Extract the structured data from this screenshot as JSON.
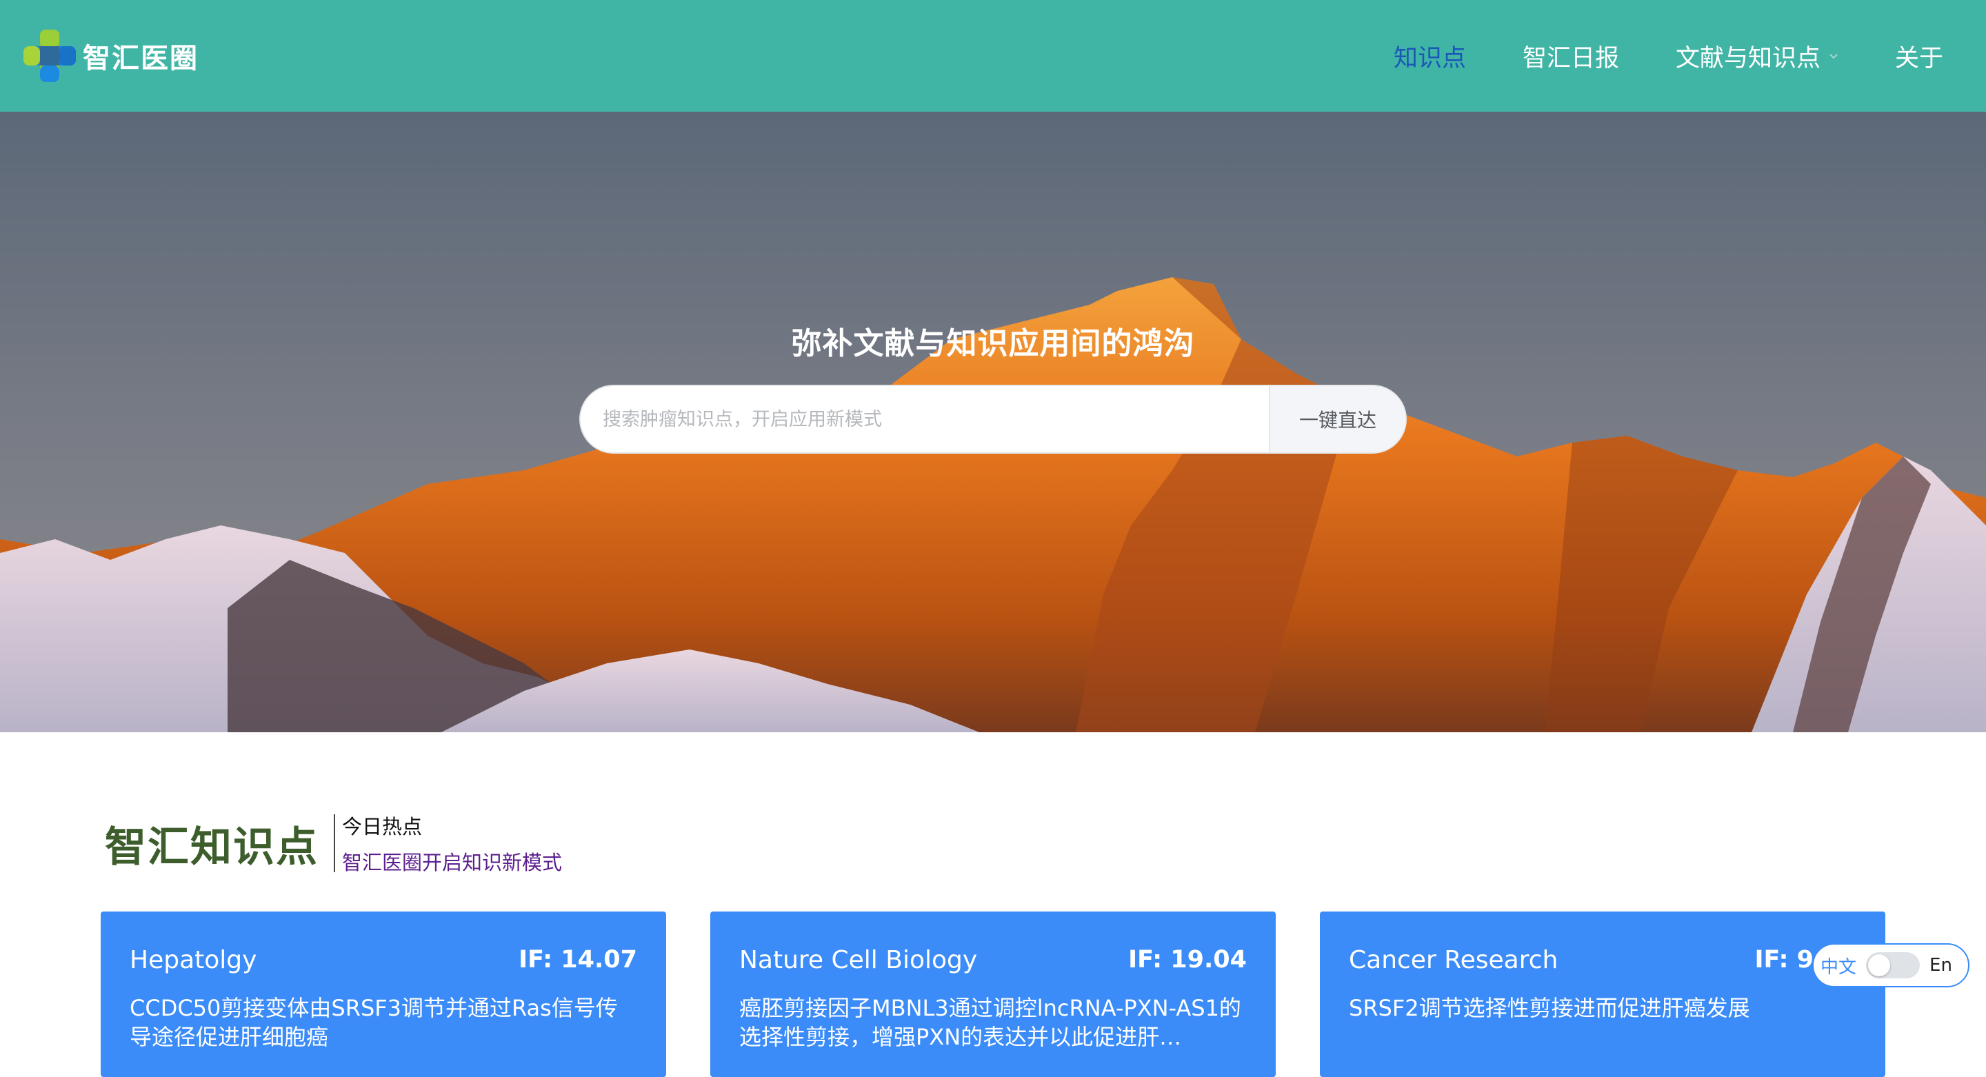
{
  "header": {
    "logo_text": "智汇医圈",
    "nav": [
      {
        "label": "知识点",
        "active": true
      },
      {
        "label": "智汇日报",
        "active": false
      },
      {
        "label": "文献与知识点",
        "active": false,
        "dropdown": true
      },
      {
        "label": "关于",
        "active": false
      }
    ]
  },
  "hero": {
    "title": "弥补文献与知识应用间的鸿沟",
    "search_placeholder": "搜索肿瘤知识点，开启应用新模式",
    "search_button": "一键直达"
  },
  "section": {
    "brand": "智汇知识点",
    "subtitle": "今日热点",
    "tagline": "智汇医圈开启知识新模式"
  },
  "cards": [
    {
      "journal": "Hepatolgy",
      "if": "IF: 14.07",
      "desc": "CCDC50剪接变体由SRSF3调节并通过Ras信号传导途径促进肝细胞癌"
    },
    {
      "journal": "Nature Cell Biology",
      "if": "IF: 19.04",
      "desc": "癌胚剪接因子MBNL3通过调控lncRNA-PXN-AS1的选择性剪接，增强PXN的表达并以此促进肝…"
    },
    {
      "journal": "Cancer Research",
      "if": "IF: 9.73",
      "desc": "SRSF2调节选择性剪接进而促进肝癌发展"
    }
  ],
  "lang_toggle": {
    "zh": "中文",
    "en": "En",
    "state": "zh"
  },
  "colors": {
    "header": "#41b5a5",
    "active_nav": "#1a56b8",
    "card": "#3b8cf8",
    "brand": "#3d5e2c"
  }
}
